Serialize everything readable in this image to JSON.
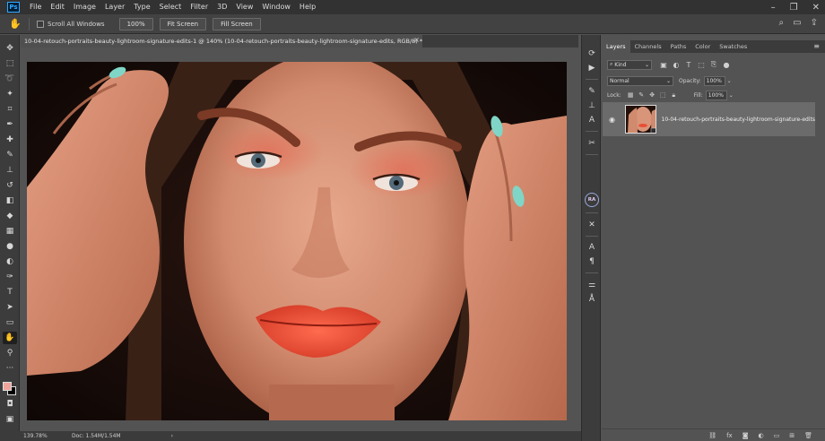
{
  "app": {
    "logo": "Ps",
    "menu": [
      "File",
      "Edit",
      "Image",
      "Layer",
      "Type",
      "Select",
      "Filter",
      "3D",
      "View",
      "Window",
      "Help"
    ]
  },
  "options_bar": {
    "scroll_all_label": "Scroll All Windows",
    "zoom_btn": "100%",
    "fit_screen_btn": "Fit Screen",
    "fill_screen_btn": "Fill Screen"
  },
  "document": {
    "tab_title": "10-04-retouch-portraits-beauty-lightroom-signature-edits-1 @ 140% (10-04-retouch-portraits-beauty-lightroom-signature-edits, RGB/8) *",
    "close": "×"
  },
  "status_bar": {
    "zoom": "139.78%",
    "doc": "Doc: 1.54M/1.54M",
    "arrow": "›"
  },
  "tools": [
    "move-icon",
    "marquee-icon",
    "lasso-icon",
    "magic-wand-icon",
    "crop-icon",
    "eyedropper-icon",
    "healing-icon",
    "brush-icon",
    "clone-stamp-icon",
    "history-brush-icon",
    "eraser-icon",
    "paint-bucket-icon",
    "gradient-icon",
    "blur-icon",
    "dodge-icon",
    "pen-icon",
    "type-icon",
    "path-select-icon",
    "shape-icon",
    "hand-icon",
    "zoom-icon",
    "more-icon"
  ],
  "colors": {
    "foreground": "#f0a39a",
    "background": "#000000",
    "accent": "#31a8ff"
  },
  "strip": {
    "ra_badge": "RA"
  },
  "layers_panel": {
    "tabs": [
      "Layers",
      "Channels",
      "Paths",
      "Color",
      "Swatches"
    ],
    "active_tab": "Layers",
    "kind_label": "Kind",
    "blend_mode": "Normal",
    "opacity_label": "Opacity:",
    "opacity_value": "100%",
    "lock_label": "Lock:",
    "fill_label": "Fill:",
    "fill_value": "100%",
    "layer": {
      "name": "10-04-retouch-portraits-beauty-lightroom-signature-edits",
      "visible": true
    },
    "footer_icons": [
      "link-icon",
      "fx-icon",
      "mask-icon",
      "adjustment-icon",
      "group-icon",
      "new-layer-icon",
      "trash-icon"
    ],
    "fx_label": "fx"
  }
}
